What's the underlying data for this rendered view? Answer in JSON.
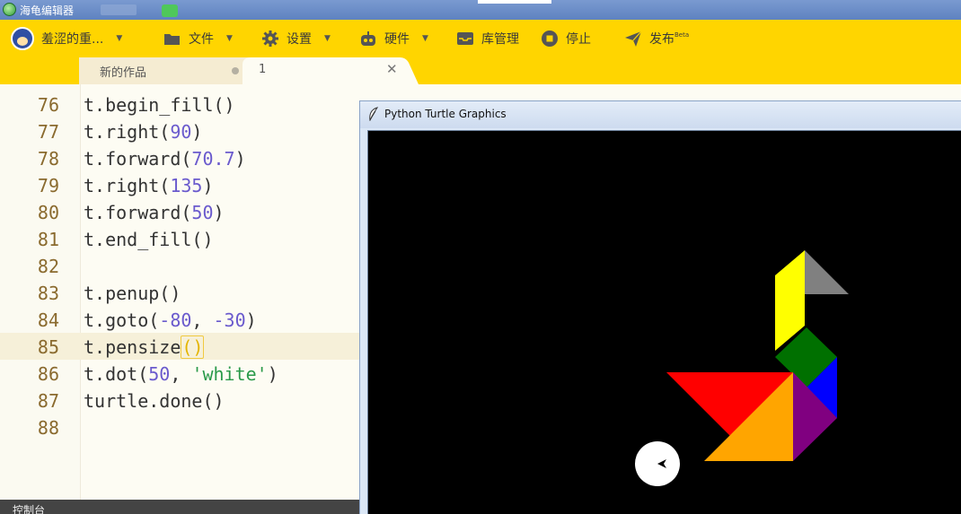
{
  "os_window": {
    "title": "海龟编辑器"
  },
  "menu": {
    "user": {
      "label": "羞涩的重..."
    },
    "file": {
      "label": "文件"
    },
    "settings": {
      "label": "设置"
    },
    "hardware": {
      "label": "硬件"
    },
    "library": {
      "label": "库管理"
    },
    "stop": {
      "label": "停止"
    },
    "publish": {
      "label": "发布",
      "badge": "Beta"
    }
  },
  "tabs": [
    {
      "label": "新的作品",
      "modified": true
    },
    {
      "label": "1",
      "active": true
    }
  ],
  "editor": {
    "active_line": 85,
    "lines": [
      {
        "n": "76",
        "code": "t.begin_fill()"
      },
      {
        "n": "77",
        "code": "t.right(90)"
      },
      {
        "n": "78",
        "code": "t.forward(70.7)"
      },
      {
        "n": "79",
        "code": "t.right(135)"
      },
      {
        "n": "80",
        "code": "t.forward(50)"
      },
      {
        "n": "81",
        "code": "t.end_fill()"
      },
      {
        "n": "82",
        "code": ""
      },
      {
        "n": "83",
        "code": "t.penup()"
      },
      {
        "n": "84",
        "code": "t.goto(-80, -30)"
      },
      {
        "n": "85",
        "code": "t.pensize()"
      },
      {
        "n": "86",
        "code": "t.dot(50, 'white')"
      },
      {
        "n": "87",
        "code": "turtle.done()"
      },
      {
        "n": "88",
        "code": ""
      }
    ]
  },
  "console": {
    "label": "控制台"
  },
  "turtle_window": {
    "title": "Python Turtle Graphics",
    "background": "#000000",
    "shape_colors": {
      "yellow": "#ffff00",
      "gray": "#808080",
      "green": "#007000",
      "blue": "#0000ff",
      "red": "#ff0000",
      "orange": "#ffa500",
      "purple": "#800080",
      "dot": "#ffffff"
    }
  },
  "colors": {
    "accent": "#ffd500",
    "editor_bg": "#fdfcf3",
    "line_number": "#8a6a2e",
    "number": "#6a5acd",
    "string": "#2a9a4a"
  }
}
